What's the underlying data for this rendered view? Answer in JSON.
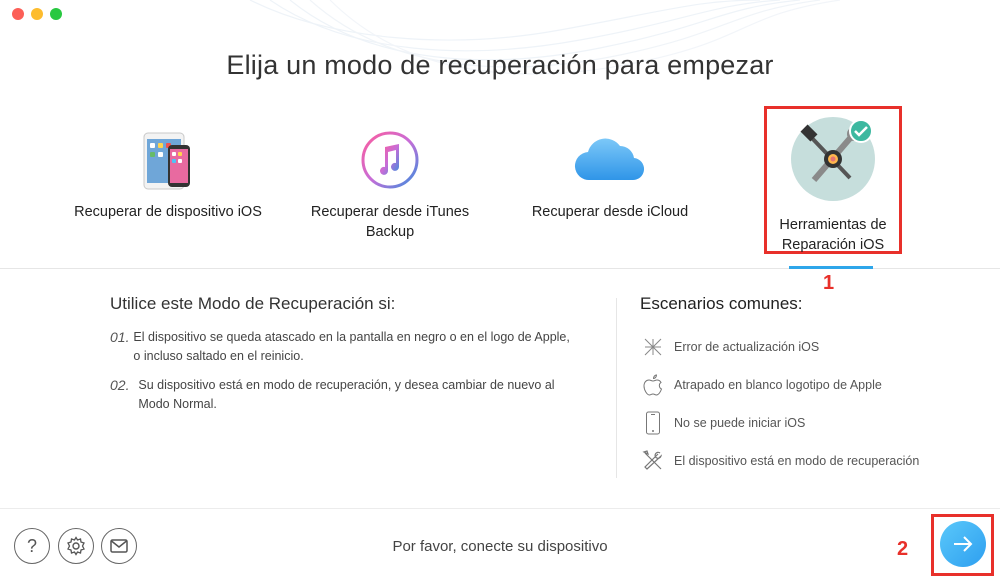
{
  "window": {
    "title": "Elija un modo de recuperación para empezar"
  },
  "modes": [
    {
      "label": "Recuperar de dispositivo iOS",
      "icon": "ios-devices-icon"
    },
    {
      "label": "Recuperar desde iTunes Backup",
      "icon": "itunes-icon"
    },
    {
      "label": "Recuperar desde iCloud",
      "icon": "icloud-icon"
    },
    {
      "label": "Herramientas de Reparación iOS",
      "icon": "repair-tools-icon",
      "selected": true
    }
  ],
  "callouts": {
    "one": "1",
    "two": "2"
  },
  "usage": {
    "heading": "Utilice este Modo de Recuperación si:",
    "steps": [
      {
        "num": "01.",
        "text": "El dispositivo se queda atascado en la pantalla en negro o en el logo de Apple, o incluso saltado en el reinicio."
      },
      {
        "num": "02.",
        "text": "Su dispositivo está en modo de recuperación, y desea cambiar de nuevo al Modo Normal."
      }
    ]
  },
  "scenarios": {
    "heading": "Escenarios comunes:",
    "items": [
      {
        "text": "Error de actualización iOS",
        "icon": "update-error-icon"
      },
      {
        "text": "Atrapado en blanco logotipo de Apple",
        "icon": "apple-logo-icon"
      },
      {
        "text": "No se puede iniciar iOS",
        "icon": "phone-icon"
      },
      {
        "text": "El dispositivo está en modo de recuperación",
        "icon": "tools-icon"
      }
    ]
  },
  "footer": {
    "status": "Por favor, conecte su dispositivo",
    "help_symbol": "?"
  },
  "colors": {
    "accent": "#2ea6ea",
    "highlight": "#e8302a",
    "next_button": "#3aaaf2"
  }
}
